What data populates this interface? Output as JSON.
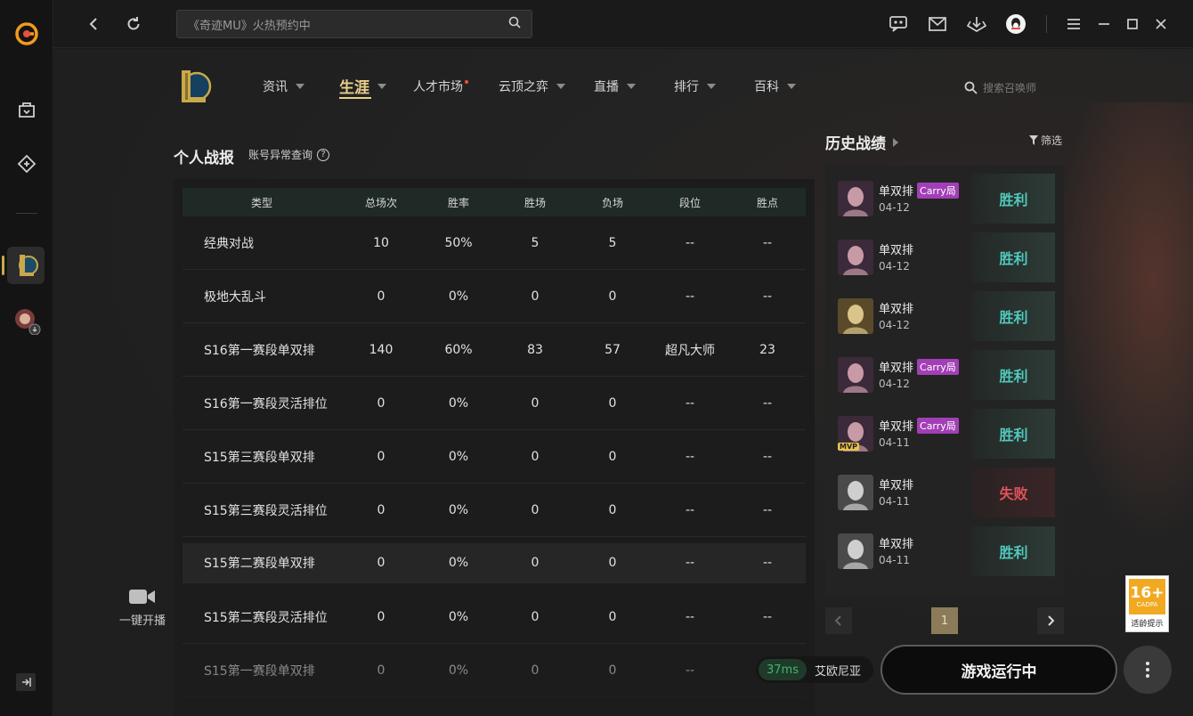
{
  "titlebar": {
    "search_placeholder": "《奇迹MU》火热预约中",
    "icons": [
      "back-icon",
      "refresh-icon",
      "search-icon",
      "chat-icon",
      "mail-icon",
      "download-icon",
      "qq-avatar-icon",
      "menu-icon",
      "minimize-icon",
      "maximize-icon",
      "close-icon"
    ]
  },
  "nav": {
    "items": [
      {
        "label": "资讯",
        "caret": true
      },
      {
        "label": "生涯",
        "caret": true,
        "active": true
      },
      {
        "label": "人才市场",
        "caret": false,
        "dot": true
      },
      {
        "label": "云顶之弈",
        "caret": true
      },
      {
        "label": "直播",
        "caret": true
      },
      {
        "label": "排行",
        "caret": true
      },
      {
        "label": "百科",
        "caret": true
      }
    ],
    "summoner_search_placeholder": "搜索召唤师"
  },
  "stats": {
    "title": "个人战报",
    "subtitle": "账号异常查询",
    "headers": [
      "类型",
      "总场次",
      "胜率",
      "胜场",
      "负场",
      "段位",
      "胜点"
    ],
    "rows": [
      [
        "经典对战",
        "10",
        "50%",
        "5",
        "5",
        "--",
        "--"
      ],
      [
        "极地大乱斗",
        "0",
        "0%",
        "0",
        "0",
        "--",
        "--"
      ],
      [
        "S16第一赛段单双排",
        "140",
        "60%",
        "83",
        "57",
        "超凡大师",
        "23"
      ],
      [
        "S16第一赛段灵活排位",
        "0",
        "0%",
        "0",
        "0",
        "--",
        "--"
      ],
      [
        "S15第三赛段单双排",
        "0",
        "0%",
        "0",
        "0",
        "--",
        "--"
      ],
      [
        "S15第三赛段灵活排位",
        "0",
        "0%",
        "0",
        "0",
        "--",
        "--"
      ],
      [
        "S15第二赛段单双排",
        "0",
        "0%",
        "0",
        "0",
        "--",
        "--"
      ],
      [
        "S15第二赛段灵活排位",
        "0",
        "0%",
        "0",
        "0",
        "--",
        "--"
      ],
      [
        "S15第一赛段单双排",
        "0",
        "0%",
        "0",
        "0",
        "--",
        "--"
      ]
    ]
  },
  "history": {
    "title": "历史战绩",
    "filter_label": "筛选",
    "matches": [
      {
        "mode": "单双排",
        "tag": "Carry局",
        "date": "04-12",
        "result": "胜利",
        "win": true,
        "mvp": false
      },
      {
        "mode": "单双排",
        "tag": "",
        "date": "04-12",
        "result": "胜利",
        "win": true,
        "mvp": false
      },
      {
        "mode": "单双排",
        "tag": "",
        "date": "04-12",
        "result": "胜利",
        "win": true,
        "mvp": false
      },
      {
        "mode": "单双排",
        "tag": "Carry局",
        "date": "04-12",
        "result": "胜利",
        "win": true,
        "mvp": false
      },
      {
        "mode": "单双排",
        "tag": "Carry局",
        "date": "04-11",
        "result": "胜利",
        "win": true,
        "mvp": true
      },
      {
        "mode": "单双排",
        "tag": "",
        "date": "04-11",
        "result": "失败",
        "win": false,
        "mvp": false
      },
      {
        "mode": "单双排",
        "tag": "",
        "date": "04-11",
        "result": "胜利",
        "win": true,
        "mvp": false
      }
    ],
    "mvp_label": "MVP",
    "page": "1"
  },
  "sidebar": {
    "stream_label": "一键开播"
  },
  "bottom": {
    "ping": "37ms",
    "server": "艾欧尼亚",
    "launch_label": "游戏运行中"
  },
  "rating": {
    "age": "16+",
    "org": "CADPA",
    "note": "适龄提示"
  },
  "colors": {
    "accent_gold": "#e8cf8a",
    "win": "#51c9bd",
    "loss": "#e2525b",
    "carry": "#a23fb6",
    "ping_ok": "#43b66a"
  }
}
